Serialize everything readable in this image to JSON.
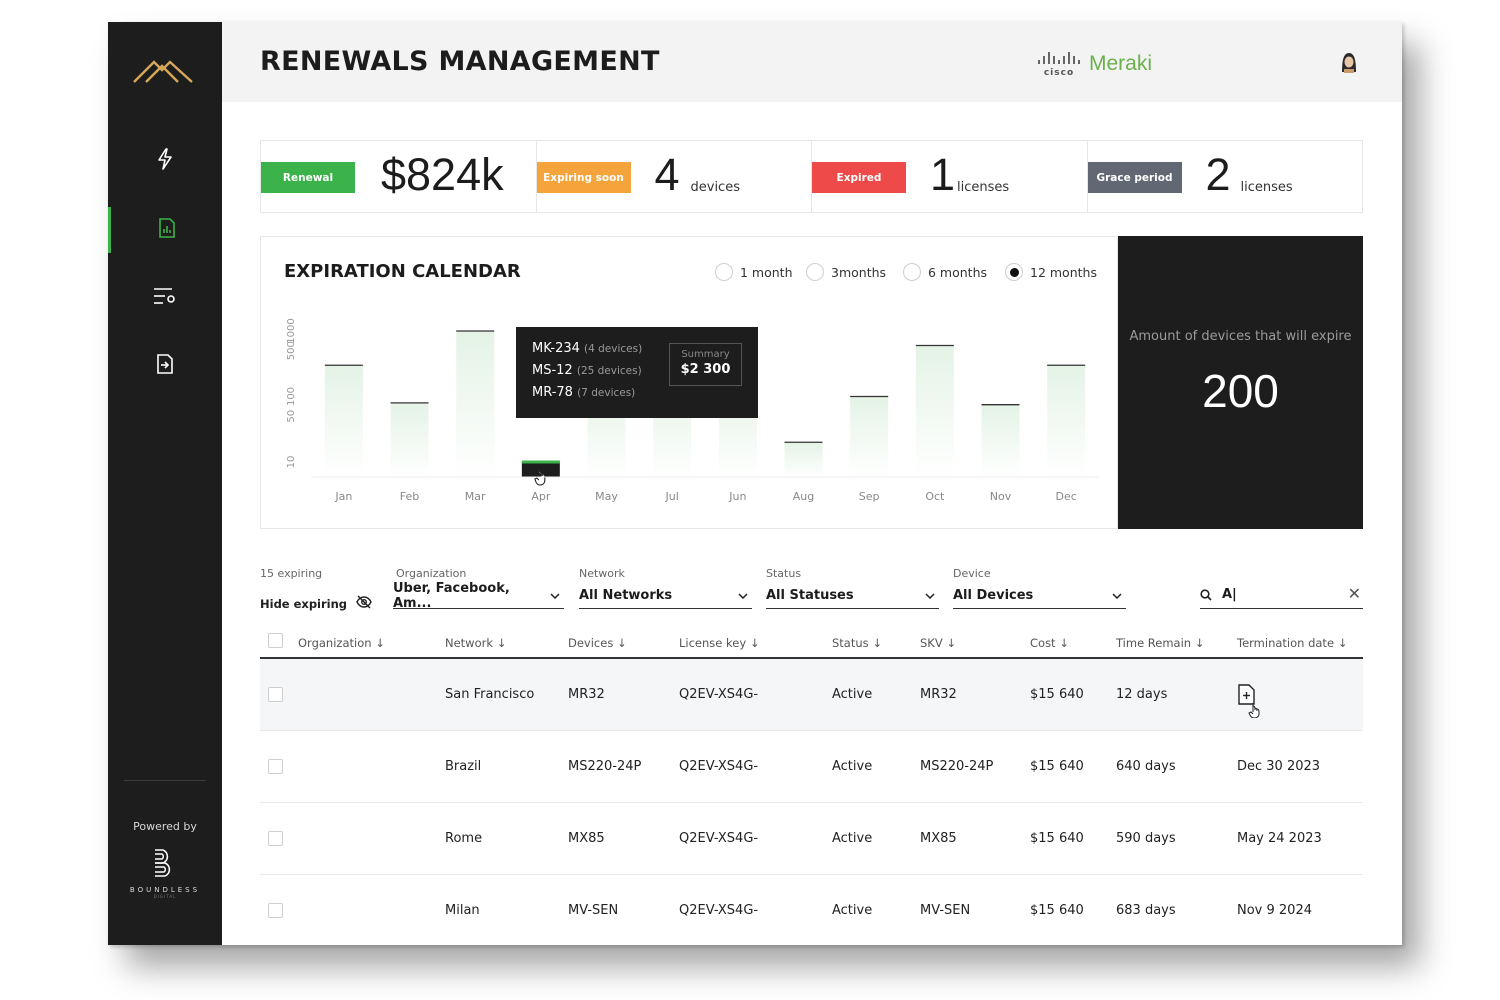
{
  "app": {
    "title": "RENEWALS MANAGEMENT",
    "partner_brand": {
      "cisco_label": "cisco",
      "name": "Meraki"
    }
  },
  "sidebar": {
    "items": [
      {
        "icon": "lightning-icon",
        "active": false
      },
      {
        "icon": "report-icon",
        "active": true
      },
      {
        "icon": "list-settings-icon",
        "active": false
      },
      {
        "icon": "file-export-icon",
        "active": false
      }
    ],
    "powered_by": "Powered by",
    "brand_name": "BOUNDLESS",
    "brand_sub": "DIGITAL"
  },
  "stats": [
    {
      "badge": "Renewal",
      "value": "$824k",
      "unit": "",
      "color": "#3bb34a"
    },
    {
      "badge": "Expiring soon",
      "value": "4",
      "unit": "devices",
      "color": "#f5a33b"
    },
    {
      "badge": "Expired",
      "value": "1",
      "unit": "licenses",
      "color": "#ee4a4a"
    },
    {
      "badge": "Grace period",
      "value": "2",
      "unit": "licenses",
      "color": "#626873"
    }
  ],
  "calendar": {
    "title": "EXPIRATION CALENDAR",
    "ranges": [
      {
        "label": "1 month",
        "selected": false
      },
      {
        "label": "3months",
        "selected": false
      },
      {
        "label": "6 months",
        "selected": false
      },
      {
        "label": "12 months",
        "selected": true
      }
    ],
    "tooltip": {
      "rows": [
        {
          "name": "MK-234",
          "detail": "(4 devices)"
        },
        {
          "name": "MS-12",
          "detail": "(25 devices)"
        },
        {
          "name": "MR-78",
          "detail": "(7 devices)"
        }
      ],
      "summary_label": "Summary",
      "summary_value": "$2 300"
    }
  },
  "chart_data": {
    "type": "bar",
    "categories": [
      "Jan",
      "Feb",
      "Mar",
      "Apr",
      "May",
      "Jul",
      "Jun",
      "Aug",
      "Sep",
      "Oct",
      "Nov",
      "Dec"
    ],
    "y_ticks": [
      "10",
      "50",
      "100",
      "500",
      "1000"
    ],
    "values": [
      300,
      80,
      1000,
      10,
      150,
      150,
      150,
      20,
      100,
      600,
      75,
      300
    ],
    "highlighted_category": "Apr",
    "colors": {
      "bar_top": "#e4f3e6",
      "bar_line": "#333333",
      "highlight": "#1d1d1d",
      "highlight_top": "#3bb34a"
    }
  },
  "amount_panel": {
    "label": "Amount of devices that will expire",
    "value": "200"
  },
  "filters": {
    "expiring_count": "15 expiring",
    "hide_label": "Hide expiring",
    "organization": {
      "label": "Organization",
      "value": "Uber, Facebook, Am..."
    },
    "network": {
      "label": "Network",
      "value": "All Networks"
    },
    "status": {
      "label": "Status",
      "value": "All Statuses"
    },
    "device": {
      "label": "Device",
      "value": "All Devices"
    },
    "search_value": "A|"
  },
  "table": {
    "columns": [
      "Organization",
      "Network",
      "Devices",
      "License key",
      "Status",
      "SKV",
      "Cost",
      "Time Remain",
      "Termination date"
    ],
    "rows": [
      {
        "organization": "",
        "network": "San Francisco",
        "devices": "MR32",
        "license": "Q2EV-XS4G-",
        "status": "Active",
        "skv": "MR32",
        "cost": "$15 640",
        "remain": "12 days",
        "termination": ""
      },
      {
        "organization": "",
        "network": "Brazil",
        "devices": "MS220-24P",
        "license": "Q2EV-XS4G-",
        "status": "Active",
        "skv": "MS220-24P",
        "cost": "$15 640",
        "remain": "640 days",
        "termination": "Dec 30 2023"
      },
      {
        "organization": "",
        "network": "Rome",
        "devices": "MX85",
        "license": "Q2EV-XS4G-",
        "status": "Active",
        "skv": "MX85",
        "cost": "$15 640",
        "remain": "590 days",
        "termination": "May 24 2023"
      },
      {
        "organization": "",
        "network": "Milan",
        "devices": "MV-SEN",
        "license": "Q2EV-XS4G-",
        "status": "Active",
        "skv": "MV-SEN",
        "cost": "$15 640",
        "remain": "683 days",
        "termination": "Nov 9 2024"
      }
    ]
  }
}
